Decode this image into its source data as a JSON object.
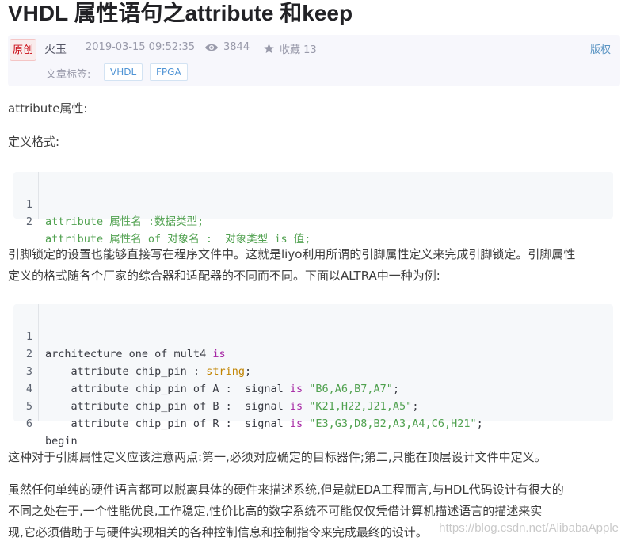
{
  "title": "VHDL 属性语句之attribute 和keep",
  "meta": {
    "badge": "原创",
    "author": "火玉",
    "datetime": "2019-03-15 09:52:35",
    "views": "3844",
    "favorites_label": "收藏 13",
    "copyright": "版权",
    "tags_label": "文章标签:",
    "tags": [
      "VHDL",
      "FPGA"
    ]
  },
  "paragraphs": {
    "p1": "attribute属性:",
    "p2": "定义格式:",
    "p3a": "引脚锁定的设置也能够直接写在程序文件中。这就是liyo利用所谓的引脚属性定义来完成引脚锁定。引脚属性",
    "p3b": "定义的格式随各个厂家的综合器和适配器的不同而不同。下面以ALTRA中一种为例:",
    "p4": "这种对于引脚属性定义应该注意两点:第一,必须对应确定的目标器件;第二,只能在顶层设计文件中定义。",
    "p5a": "虽然任何单纯的硬件语言都可以脱离具体的硬件来描述系统,但是就EDA工程而言,与HDL代码设计有很大的",
    "p5b": "不同之处在于,一个性能优良,工作稳定,性价比高的数字系统不可能仅仅凭借计算机描述语言的描述来实",
    "p5c": "现,它必须借助于与硬件实现相关的各种控制信息和控制指令来完成最终的设计。"
  },
  "code1": {
    "lines": [
      {
        "n": "1",
        "text": "attribute 属性名 :数据类型;"
      },
      {
        "n": "2",
        "text": "attribute 属性名 of 对象名 :  对象类型 is 值;"
      }
    ]
  },
  "code2": {
    "lines": [
      {
        "n": "1",
        "a": "architecture one of mult4 ",
        "kw": "is"
      },
      {
        "n": "2",
        "a": "    attribute chip_pin : ",
        "typ": "string",
        "b": ";"
      },
      {
        "n": "3",
        "a": "    attribute chip_pin of A :  signal ",
        "kw": "is",
        "sp": " ",
        "str": "\"B6,A6,B7,A7\"",
        "b": ";"
      },
      {
        "n": "4",
        "a": "    attribute chip_pin of B :  signal ",
        "kw": "is",
        "sp": " ",
        "str": "\"K21,H22,J21,A5\"",
        "b": ";"
      },
      {
        "n": "5",
        "a": "    attribute chip_pin of R :  signal ",
        "kw": "is",
        "sp": " ",
        "str": "\"E3,G3,D8,B2,A3,A4,C6,H21\"",
        "b": ";"
      },
      {
        "n": "6",
        "a": "begin"
      }
    ]
  },
  "watermark": "https://blog.csdn.net/AlibabaApple",
  "colors": {
    "keyword": "#a626a4",
    "string": "#50a14f",
    "type": "#c18401",
    "badge_text": "#ca0c16",
    "tag_text": "#5094d5",
    "meta_bg": "#f7f7fc",
    "code_bg": "#f6f8fa"
  },
  "icons": [
    "eye-icon",
    "star-icon"
  ]
}
